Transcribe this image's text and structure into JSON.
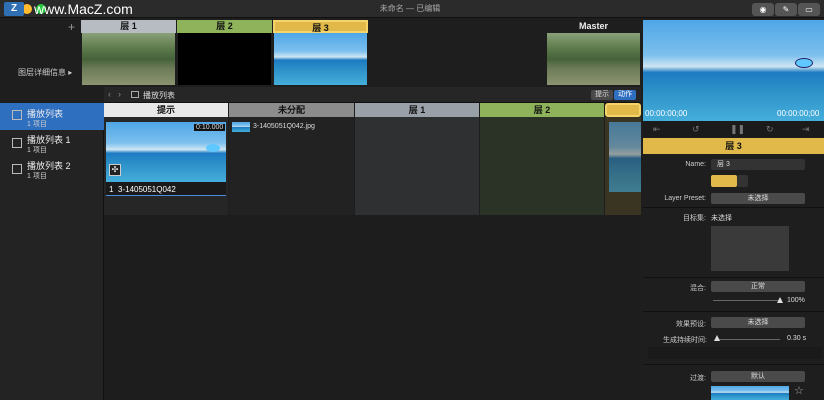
{
  "watermark": {
    "logo": "Z",
    "text": "www.MacZ.com"
  },
  "window": {
    "title": "未命名 — 已编辑"
  },
  "layers_bar": {
    "add_symbol": "+",
    "detail_label": "图层详细信息 ▸",
    "tabs": [
      {
        "label": "层 1",
        "color": "#b7bcc3"
      },
      {
        "label": "层 2",
        "color": "#8fb35a"
      },
      {
        "label": "层 3",
        "color": "#e0b94a"
      }
    ],
    "master_label": "Master"
  },
  "preview": {
    "timecode_left": "00:00:00;00",
    "timecode_right": "00:00:00;00"
  },
  "toolbar": {
    "breadcrumb": "播放列表",
    "tab_hint": "提示",
    "tab_action": "动作"
  },
  "sidebar": {
    "items": [
      {
        "title": "播放列表",
        "count": "1 项目",
        "selected": true
      },
      {
        "title": "播放列表 1",
        "count": "1 项目",
        "selected": false
      },
      {
        "title": "播放列表 2",
        "count": "1 项目",
        "selected": false
      }
    ]
  },
  "columns": {
    "cue": {
      "header": "提示",
      "timecode": "0:10.000",
      "cue_number": "1",
      "cue_name": "3-1405051Q042"
    },
    "unassigned": {
      "header": "未分配",
      "file_name": "3-1405051Q042.jpg"
    },
    "layer1": {
      "header": "层 1"
    },
    "layer2": {
      "header": "层 2"
    }
  },
  "inspector": {
    "layer_title": "层 3",
    "name_label": "Name:",
    "name_value": "层 3",
    "preset_label": "Layer Preset:",
    "preset_value": "未选择",
    "target_label": "目标集:",
    "target_value": "未选择",
    "blend_label": "混合:",
    "blend_value": "正常",
    "opacity": "100%",
    "opacity_fraction": 1.0,
    "effect_label": "效果预设:",
    "effect_value": "未选择",
    "duration_label": "生成持续时间:",
    "duration_value": "0.30 s",
    "transition_label": "过渡:",
    "transition_value": "默认"
  }
}
